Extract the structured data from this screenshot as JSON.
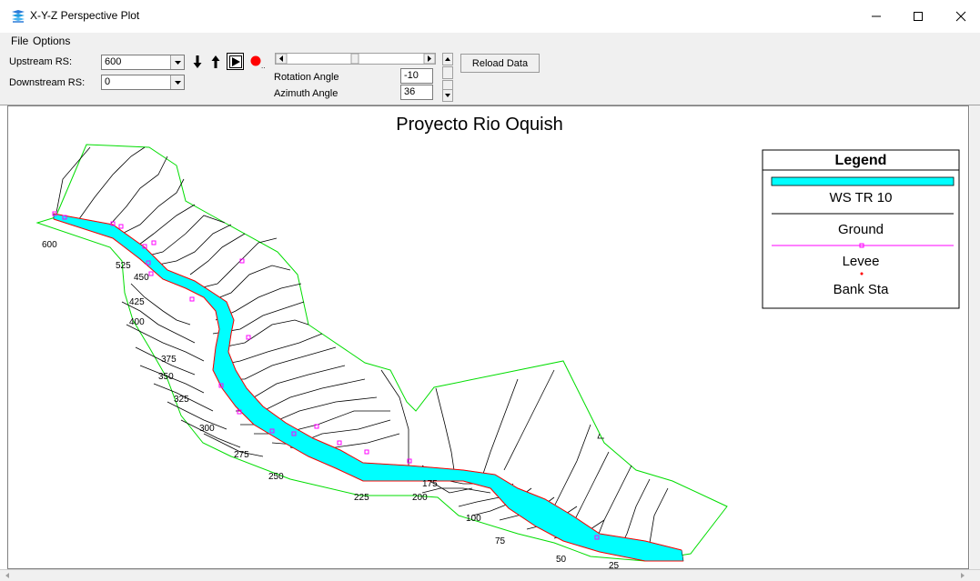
{
  "window": {
    "title": "X-Y-Z Perspective Plot",
    "icon": "stacked-layers-icon",
    "controls": [
      "minimize-icon",
      "maximize-icon",
      "close-icon"
    ]
  },
  "menu": {
    "file": "File",
    "options": "Options"
  },
  "toolbar": {
    "upstream_label": "Upstream RS:",
    "upstream_value": "600",
    "downstream_label": "Downstream RS:",
    "downstream_value": "0",
    "rotation_label": "Rotation Angle",
    "rotation_value": "-10",
    "azimuth_label": "Azimuth Angle",
    "azimuth_value": "36",
    "reload_label": "Reload Data",
    "icons": [
      "arrow-down-icon",
      "arrow-up-icon",
      "play-icon",
      "record-icon"
    ]
  },
  "plot": {
    "title": "Proyecto Rio Oquish",
    "legend": {
      "title": "Legend",
      "items": [
        "WS TR 10",
        "Ground",
        "Levee",
        "Bank Sta"
      ]
    },
    "colors": {
      "water": "#00ffff",
      "ground": "#000000",
      "levee": "#ff00ff",
      "bank": "#ff0000",
      "boundary": "#00dd00"
    },
    "stations": [
      "600",
      "525",
      "450",
      "425",
      "400",
      "375",
      "350",
      "325",
      "300",
      "275",
      "250",
      "225",
      "200",
      "175",
      "100",
      "75",
      "50",
      "25"
    ]
  }
}
